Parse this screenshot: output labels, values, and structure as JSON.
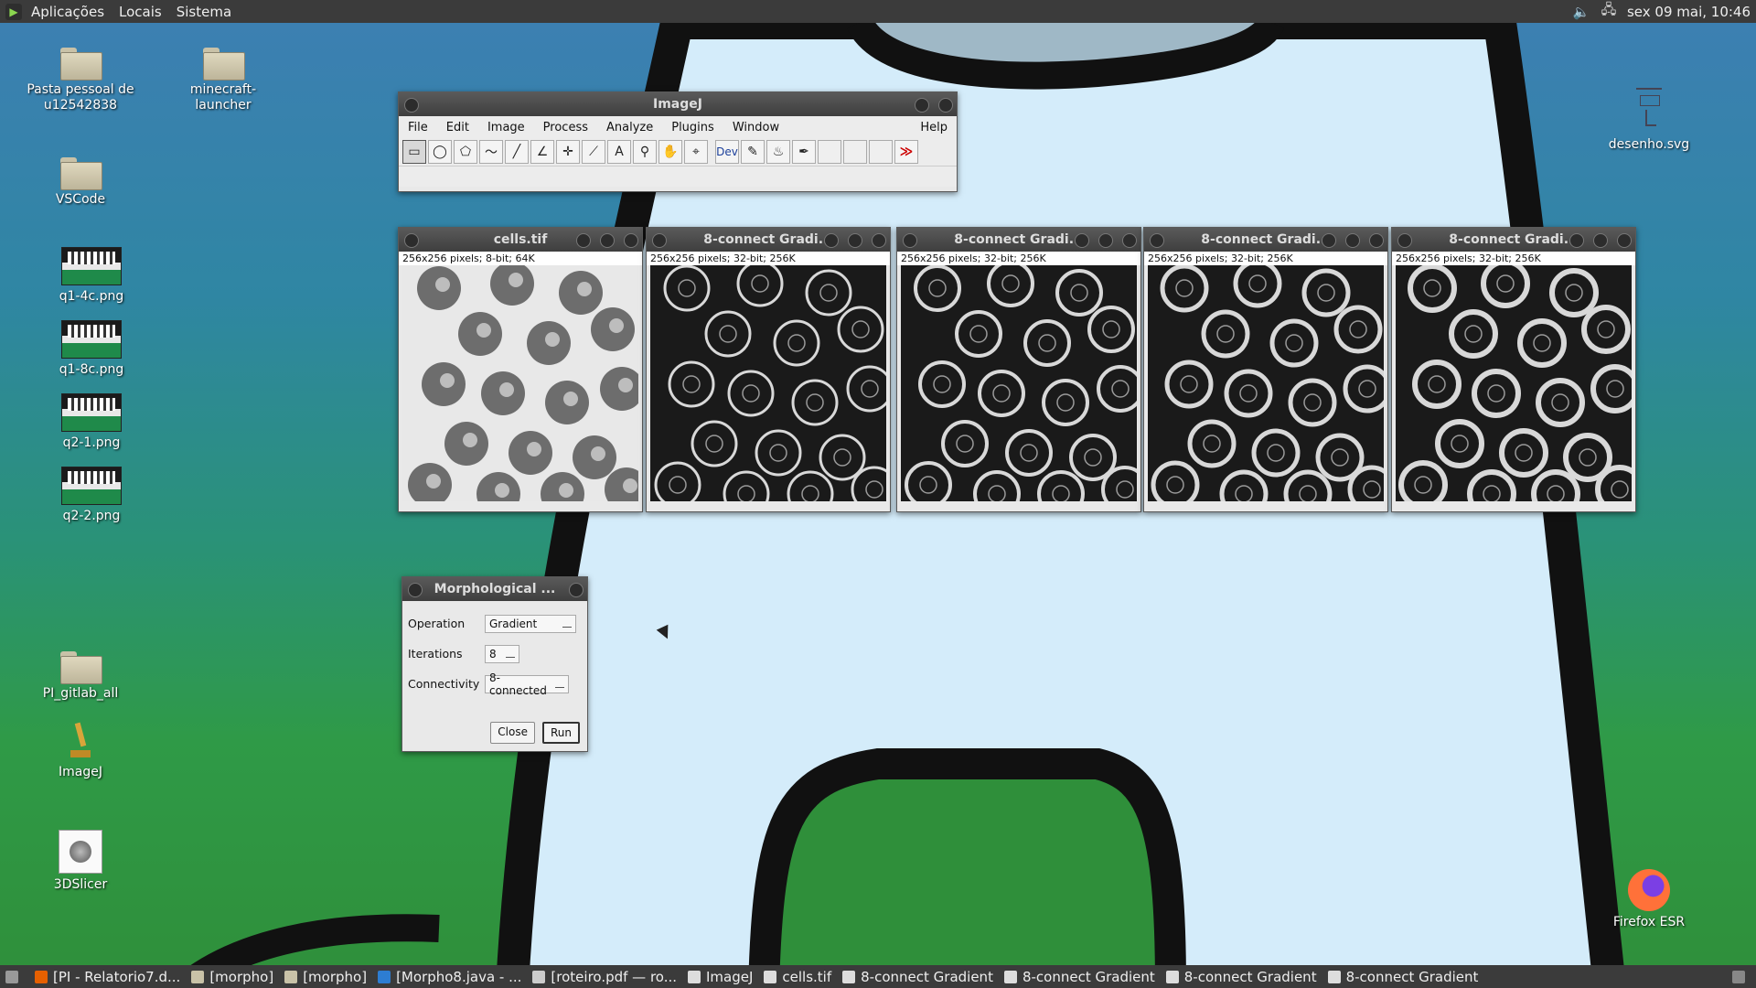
{
  "top_panel": {
    "menus": [
      "Aplicações",
      "Locais",
      "Sistema"
    ],
    "clock": "sex 09 mai, 10:46"
  },
  "desktop_icons": [
    {
      "label": "Pasta pessoal de u12542838",
      "icon": "home-folder-icon"
    },
    {
      "label": "minecraft-launcher",
      "icon": "folder-icon"
    },
    {
      "label": "VSCode",
      "icon": "folder-icon"
    },
    {
      "label": "q1-4c.png",
      "icon": "image-file-icon"
    },
    {
      "label": "q1-8c.png",
      "icon": "image-file-icon"
    },
    {
      "label": "q2-1.png",
      "icon": "image-file-icon"
    },
    {
      "label": "q2-2.png",
      "icon": "image-file-icon"
    },
    {
      "label": "PI_gitlab_all",
      "icon": "folder-icon"
    },
    {
      "label": "ImageJ",
      "icon": "microscope-icon"
    },
    {
      "label": "3DSlicer",
      "icon": "slicer-icon"
    },
    {
      "label": "desenho.svg",
      "icon": "svg-file-icon"
    },
    {
      "label": "Firefox ESR",
      "icon": "firefox-icon"
    }
  ],
  "imagej": {
    "title": "ImageJ",
    "menus": [
      "File",
      "Edit",
      "Image",
      "Process",
      "Analyze",
      "Plugins",
      "Window"
    ],
    "help": "Help",
    "tools": [
      "rectangle",
      "oval",
      "polygon",
      "freehand",
      "line",
      "angle",
      "multipoint",
      "wand",
      "text",
      "magnifier",
      "hand",
      "dropper"
    ],
    "dev_label": "Dev",
    "more": "≫"
  },
  "image_windows": [
    {
      "title": "cells.tif",
      "info": "256x256 pixels; 8-bit; 64K",
      "variant": "original"
    },
    {
      "title": "8-connect Gradi...",
      "info": "256x256 pixels; 32-bit; 256K",
      "variant": "grad1"
    },
    {
      "title": "8-connect Gradi...",
      "info": "256x256 pixels; 32-bit; 256K",
      "variant": "grad2"
    },
    {
      "title": "8-connect Gradi...",
      "info": "256x256 pixels; 32-bit; 256K",
      "variant": "grad3"
    },
    {
      "title": "8-connect Gradi...",
      "info": "256x256 pixels; 32-bit; 256K",
      "variant": "grad4"
    }
  ],
  "morph_dialog": {
    "title": "Morphological ...",
    "operation_label": "Operation",
    "operation_value": "Gradient",
    "iterations_label": "Iterations",
    "iterations_value": "8",
    "connectivity_label": "Connectivity",
    "connectivity_value": "8-connected",
    "close_label": "Close",
    "run_label": "Run"
  },
  "taskbar": {
    "tasks": [
      {
        "label": "[PI - Relatorio7.d...",
        "icon": "firefox-icon",
        "color": "#e66000"
      },
      {
        "label": "[morpho]",
        "icon": "folder-icon",
        "color": "#c9c2a8"
      },
      {
        "label": "[morpho]",
        "icon": "folder-icon",
        "color": "#c9c2a8"
      },
      {
        "label": "[Morpho8.java - ...",
        "icon": "vscode-icon",
        "color": "#2d7dd2"
      },
      {
        "label": "[roteiro.pdf — ro...",
        "icon": "pdf-icon",
        "color": "#cccccc"
      },
      {
        "label": "ImageJ",
        "icon": "imagej-icon",
        "color": "#dddddd"
      },
      {
        "label": "cells.tif",
        "icon": "imagej-icon",
        "color": "#dddddd"
      },
      {
        "label": "8-connect Gradient",
        "icon": "imagej-icon",
        "color": "#dddddd"
      },
      {
        "label": "8-connect Gradient",
        "icon": "imagej-icon",
        "color": "#dddddd"
      },
      {
        "label": "8-connect Gradient",
        "icon": "imagej-icon",
        "color": "#dddddd"
      },
      {
        "label": "8-connect Gradient",
        "icon": "imagej-icon",
        "color": "#dddddd"
      }
    ]
  }
}
